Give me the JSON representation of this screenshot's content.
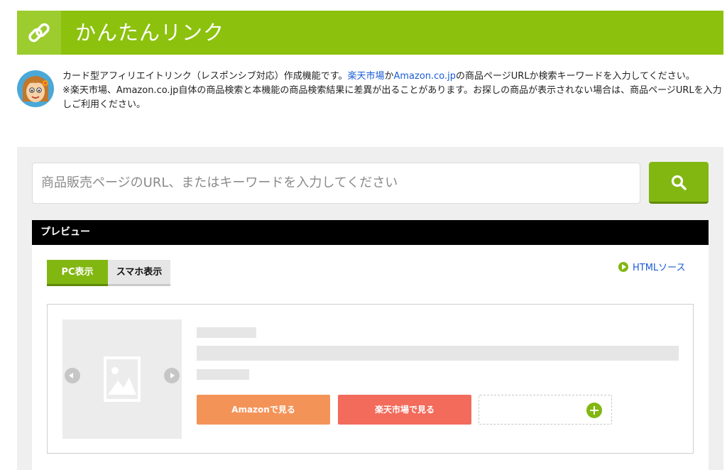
{
  "header": {
    "title": "かんたんリンク",
    "icon": "link-icon",
    "accent": "#8cc10e"
  },
  "intro": {
    "line1_prefix": "カード型アフィリエイトリンク（レスポンシブ対応）作成機能です。",
    "link_rakuten": "楽天市場",
    "connector": "か",
    "link_amazon": "Amazon.co.jp",
    "line1_suffix": "の商品ページURLか検索キーワードを入力してください。",
    "line2": "※楽天市場、Amazon.co.jp自体の商品検索と本機能の商品検索結果に差異が出ることがあります。お探しの商品が表示されない場合は、商品ページURLを入力しご利用ください。"
  },
  "search": {
    "placeholder": "商品販売ページのURL、またはキーワードを入力してください",
    "button_icon": "search-icon"
  },
  "preview": {
    "title": "プレビュー",
    "tabs": [
      {
        "label": "PC表示",
        "active": true
      },
      {
        "label": "スマホ表示",
        "active": false
      }
    ],
    "html_source_link": "HTMLソース",
    "card": {
      "amazon_button": "Amazonで見る",
      "rakuten_button": "楽天市場で見る",
      "amazon_color": "#f49358",
      "rakuten_color": "#f26b5b"
    }
  }
}
